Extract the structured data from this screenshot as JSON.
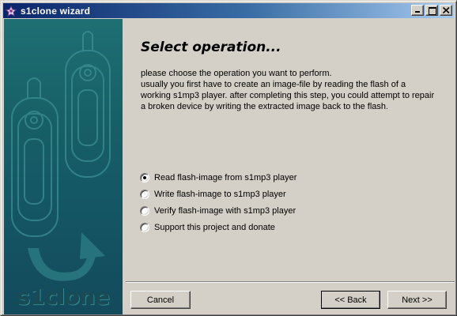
{
  "window": {
    "title": "s1clone wizard",
    "icon": "wizard-app-icon"
  },
  "banner": {
    "brand_text": "s1clone"
  },
  "page": {
    "heading": "Select operation...",
    "description_lines": [
      "please choose the operation you want to perform.",
      "usually you first have to create an image-file by reading the flash of a",
      "working s1mp3 player. after completing this step, you could attempt to repair",
      "a broken device by writing the extracted image back to the flash."
    ]
  },
  "options": [
    {
      "label": "Read flash-image from s1mp3 player",
      "checked": true
    },
    {
      "label": "Write flash-image to s1mp3 player",
      "checked": false
    },
    {
      "label": "Verify flash-image with s1mp3 player",
      "checked": false
    },
    {
      "label": "Support this project and donate",
      "checked": false
    }
  ],
  "buttons": {
    "cancel": "Cancel",
    "back": "<< Back",
    "next": "Next >>"
  },
  "colors": {
    "title_gradient_start": "#0a246a",
    "title_gradient_end": "#a6caf0",
    "banner": "#175f66",
    "face": "#d4d0c8"
  }
}
